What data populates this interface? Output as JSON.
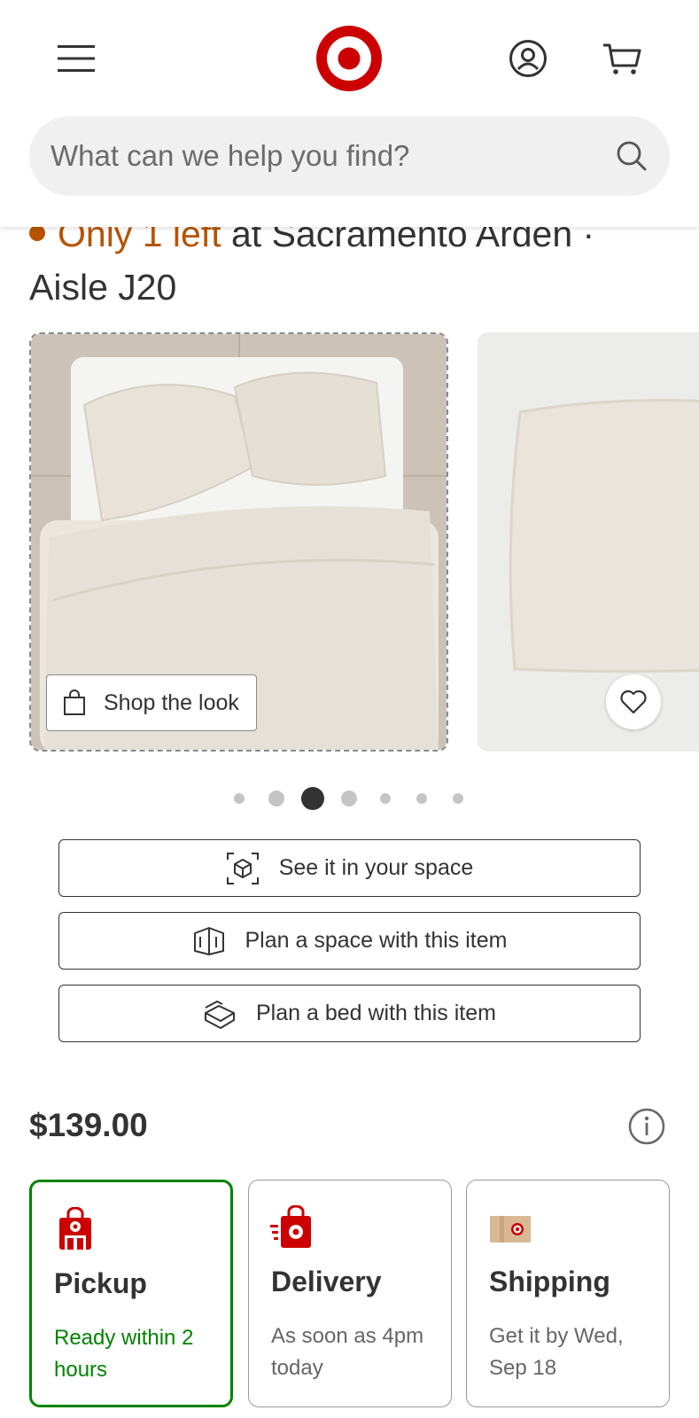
{
  "header": {
    "menu_icon": "hamburger-icon",
    "logo": "target-bullseye-logo",
    "account_icon": "account-icon",
    "cart_icon": "cart-icon",
    "search": {
      "placeholder": "What can we help you find?",
      "icon": "search-icon"
    }
  },
  "stock": {
    "only_text": "Only 1 left",
    "location_text": " at Sacramento Arden · Aisle J20"
  },
  "gallery": {
    "shop_the_look_label": "Shop the look",
    "favorite_icon": "heart-icon",
    "dots_total": 7,
    "active_dot_index": 2
  },
  "actions": {
    "see_in_space": "See it in your space",
    "plan_space": "Plan a space with this item",
    "plan_bed": "Plan a bed with this item"
  },
  "price": "$139.00",
  "fulfillment": [
    {
      "title": "Pickup",
      "subtitle": "Ready within 2 hours",
      "selected": true
    },
    {
      "title": "Delivery",
      "subtitle": "As soon as 4pm today",
      "selected": false
    },
    {
      "title": "Shipping",
      "subtitle": "Get it by Wed, Sep 18",
      "selected": false
    }
  ],
  "colors": {
    "brand_red": "#cc0000",
    "stock_orange": "#b85300",
    "selected_green": "#008300"
  }
}
